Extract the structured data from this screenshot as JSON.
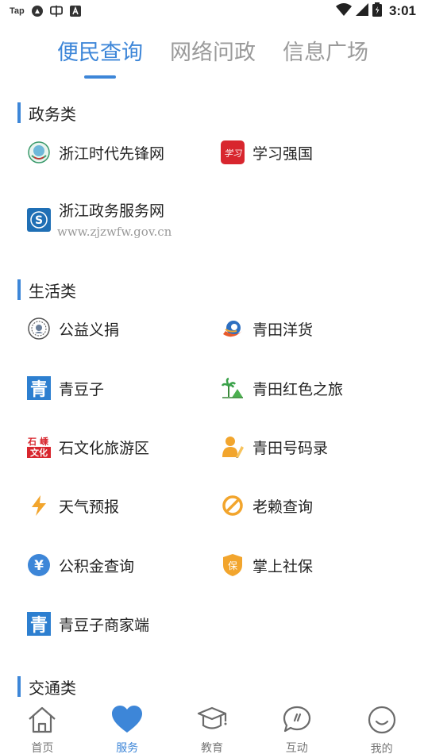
{
  "status_bar": {
    "app_text": "Tap",
    "time": "3:01",
    "icons": [
      "tap-app-icon",
      "photo-icon",
      "chat-icon",
      "font-a-icon",
      "wifi-icon",
      "signal-icon",
      "battery-icon"
    ]
  },
  "top_tabs": [
    {
      "label": "便民查询",
      "active": true
    },
    {
      "label": "网络问政",
      "active": false
    },
    {
      "label": "信息广场",
      "active": false
    }
  ],
  "sections": [
    {
      "title": "政务类",
      "items": [
        {
          "label": "浙江时代先锋网",
          "icon": "pioneer-icon"
        },
        {
          "label": "学习强国",
          "icon": "xuexi-icon"
        },
        {
          "label": "浙江政务服务网",
          "sub": "www.zjzwfw.gov.cn",
          "icon": "zjzwfw-icon"
        }
      ]
    },
    {
      "title": "生活类",
      "items": [
        {
          "label": "公益义捐",
          "icon": "charity-icon"
        },
        {
          "label": "青田洋货",
          "icon": "foreign-goods-icon"
        },
        {
          "label": "青豆子",
          "icon": "qingdouzi-icon"
        },
        {
          "label": "青田红色之旅",
          "icon": "red-tour-icon"
        },
        {
          "label": "石文化旅游区",
          "icon": "stone-culture-icon"
        },
        {
          "label": "青田号码录",
          "icon": "phonebook-icon"
        },
        {
          "label": "天气预报",
          "icon": "weather-icon"
        },
        {
          "label": "老赖查询",
          "icon": "dishonest-icon"
        },
        {
          "label": "公积金查询",
          "icon": "fund-icon"
        },
        {
          "label": "掌上社保",
          "icon": "social-security-icon"
        },
        {
          "label": "青豆子商家端",
          "icon": "qingdouzi-merchant-icon"
        }
      ]
    },
    {
      "title": "交通类",
      "items": []
    }
  ],
  "icon_text": {
    "xuexi": "学习",
    "zjzwfw": "S",
    "qingdouzi": "青",
    "stone_1": "石",
    "stone_2": "嵊",
    "stone_3": "文化",
    "fund": "¥",
    "social": "保"
  },
  "bottom_nav": [
    {
      "label": "首页",
      "icon": "home-icon",
      "active": false
    },
    {
      "label": "服务",
      "icon": "heart-icon",
      "active": true
    },
    {
      "label": "教育",
      "icon": "graduation-cap-icon",
      "active": false
    },
    {
      "label": "互动",
      "icon": "chat-bubble-icon",
      "active": false
    },
    {
      "label": "我的",
      "icon": "smile-icon",
      "active": false
    }
  ],
  "colors": {
    "accent": "#3d86d8",
    "inactive_tab": "#9a9a9a",
    "nav_inactive": "#777777",
    "orange": "#f2a52d",
    "red": "#d8262e"
  }
}
